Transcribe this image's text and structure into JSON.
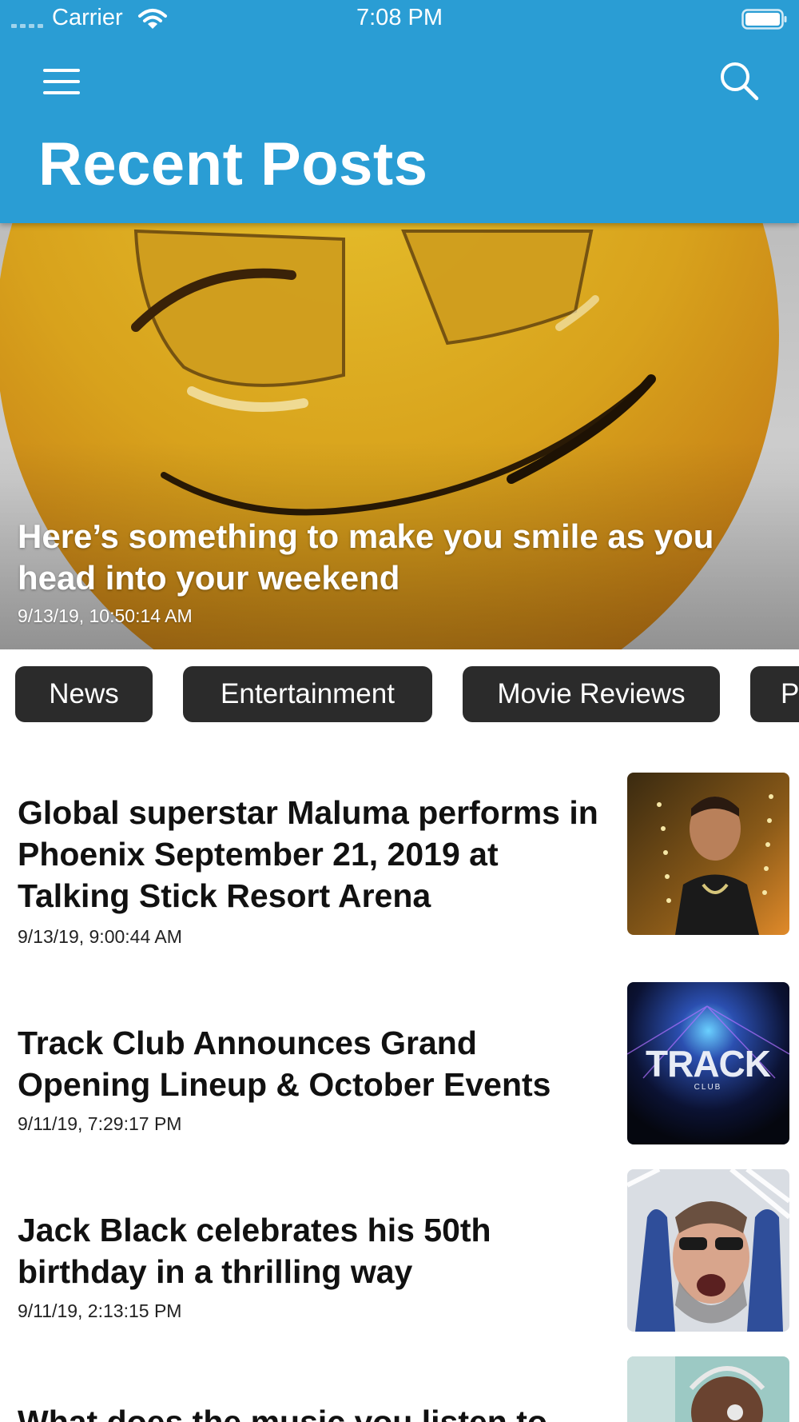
{
  "status_bar": {
    "carrier": "Carrier",
    "time": "7:08 PM"
  },
  "header": {
    "title": "Recent Posts",
    "menu_icon": "hamburger-menu-icon",
    "search_icon": "search-icon",
    "background_color": "#2a9dd4"
  },
  "hero": {
    "title": "Here’s something to make you smile as you head into your weekend",
    "date": "9/13/19, 10:50:14 AM"
  },
  "categories": [
    "News",
    "Entertainment",
    "Movie Reviews",
    "P"
  ],
  "posts": [
    {
      "title": "Global superstar Maluma performs in Phoenix September 21, 2019 at Talking Stick Resort Arena",
      "date": "9/13/19, 9:00:44 AM"
    },
    {
      "title": "Track Club Announces Grand Opening Lineup & October Events",
      "date": "9/11/19, 7:29:17 PM",
      "thumb_text": "TRACK",
      "thumb_subtext": "CLUB"
    },
    {
      "title": "Jack Black celebrates his 50th birthday in a thrilling way",
      "date": "9/11/19, 2:13:15 PM"
    },
    {
      "title": "What does the music you listen to"
    }
  ]
}
